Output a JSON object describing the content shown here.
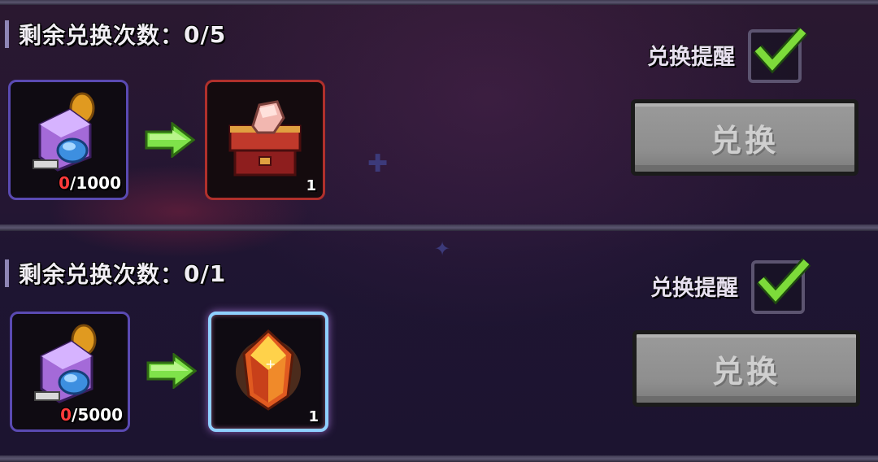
{
  "offers": [
    {
      "remaining_label": "剩余兑换次数：",
      "remaining_value": "0/5",
      "cost": {
        "icon": "gem-and-coin-pile-icon",
        "have": "0",
        "need": "/1000"
      },
      "reward": {
        "icon": "treasure-chest-with-stone-icon",
        "quantity": "1",
        "frame_color": "#b0302c"
      },
      "remind_label": "兑换提醒",
      "remind_checked": true,
      "button_label": "兑换"
    },
    {
      "remaining_label": "剩余兑换次数：",
      "remaining_value": "0/1",
      "cost": {
        "icon": "gem-and-coin-pile-icon",
        "have": "0",
        "need": "/5000"
      },
      "reward": {
        "icon": "fire-crystal-icon",
        "quantity": "1",
        "frame_color": "#8fd0ff"
      },
      "remind_label": "兑换提醒",
      "remind_checked": true,
      "button_label": "兑换"
    }
  ],
  "colors": {
    "check_green": "#7ddb3a",
    "arrow_green": "#7fe24a",
    "button_gray": "#8e8e8e",
    "have_red": "#ff3b3b"
  }
}
